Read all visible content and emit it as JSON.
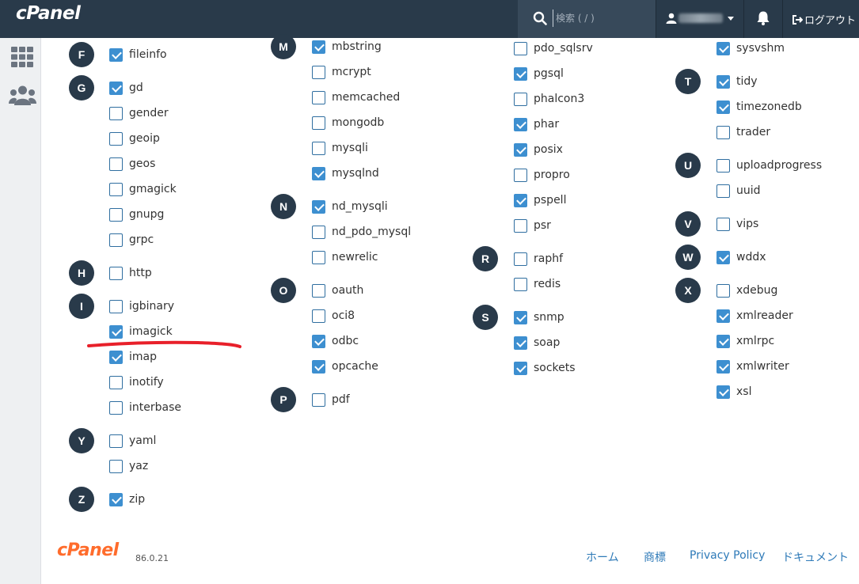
{
  "header": {
    "logo": "cPanel",
    "search_placeholder": "検索 ( / )",
    "logout_label": "ログアウト"
  },
  "groups": [
    {
      "letter": "F",
      "items": [
        {
          "label": "fileinfo",
          "checked": true
        }
      ]
    },
    {
      "letter": "G",
      "items": [
        {
          "label": "gd",
          "checked": true
        },
        {
          "label": "gender",
          "checked": false
        },
        {
          "label": "geoip",
          "checked": false
        },
        {
          "label": "geos",
          "checked": false
        },
        {
          "label": "gmagick",
          "checked": false
        },
        {
          "label": "gnupg",
          "checked": false
        },
        {
          "label": "grpc",
          "checked": false
        }
      ]
    },
    {
      "letter": "H",
      "items": [
        {
          "label": "http",
          "checked": false
        }
      ]
    },
    {
      "letter": "I",
      "items": [
        {
          "label": "igbinary",
          "checked": false
        },
        {
          "label": "imagick",
          "checked": true
        },
        {
          "label": "imap",
          "checked": true
        },
        {
          "label": "inotify",
          "checked": false
        },
        {
          "label": "interbase",
          "checked": false
        }
      ]
    },
    {
      "letter": "Y",
      "items": [
        {
          "label": "yaml",
          "checked": false
        },
        {
          "label": "yaz",
          "checked": false
        }
      ]
    },
    {
      "letter": "Z",
      "items": [
        {
          "label": "zip",
          "checked": true
        }
      ]
    },
    {
      "letter": "M",
      "items": [
        {
          "label": "mbstring",
          "checked": true
        },
        {
          "label": "mcrypt",
          "checked": false
        },
        {
          "label": "memcached",
          "checked": false
        },
        {
          "label": "mongodb",
          "checked": false
        },
        {
          "label": "mysqli",
          "checked": false
        },
        {
          "label": "mysqlnd",
          "checked": true
        }
      ]
    },
    {
      "letter": "N",
      "items": [
        {
          "label": "nd_mysqli",
          "checked": true
        },
        {
          "label": "nd_pdo_mysql",
          "checked": false
        },
        {
          "label": "newrelic",
          "checked": false
        }
      ]
    },
    {
      "letter": "O",
      "items": [
        {
          "label": "oauth",
          "checked": false
        },
        {
          "label": "oci8",
          "checked": false
        },
        {
          "label": "odbc",
          "checked": true
        },
        {
          "label": "opcache",
          "checked": true
        }
      ]
    },
    {
      "letter": "P",
      "items": [
        {
          "label": "pdf",
          "checked": false
        }
      ]
    },
    {
      "letter": "",
      "items": [
        {
          "label": "pdo_sqlsrv",
          "checked": false
        },
        {
          "label": "pgsql",
          "checked": true
        },
        {
          "label": "phalcon3",
          "checked": false
        },
        {
          "label": "phar",
          "checked": true
        },
        {
          "label": "posix",
          "checked": true
        },
        {
          "label": "propro",
          "checked": false
        },
        {
          "label": "pspell",
          "checked": true
        },
        {
          "label": "psr",
          "checked": false
        }
      ]
    },
    {
      "letter": "R",
      "items": [
        {
          "label": "raphf",
          "checked": false
        },
        {
          "label": "redis",
          "checked": false
        }
      ]
    },
    {
      "letter": "S",
      "items": [
        {
          "label": "snmp",
          "checked": true
        },
        {
          "label": "soap",
          "checked": true
        },
        {
          "label": "sockets",
          "checked": true
        }
      ]
    },
    {
      "letter": "",
      "items": [
        {
          "label": "sysvshm",
          "checked": true
        }
      ]
    },
    {
      "letter": "T",
      "items": [
        {
          "label": "tidy",
          "checked": true
        },
        {
          "label": "timezonedb",
          "checked": true
        },
        {
          "label": "trader",
          "checked": false
        }
      ]
    },
    {
      "letter": "U",
      "items": [
        {
          "label": "uploadprogress",
          "checked": false
        },
        {
          "label": "uuid",
          "checked": false
        }
      ]
    },
    {
      "letter": "V",
      "items": [
        {
          "label": "vips",
          "checked": false
        }
      ]
    },
    {
      "letter": "W",
      "items": [
        {
          "label": "wddx",
          "checked": true
        }
      ]
    },
    {
      "letter": "X",
      "items": [
        {
          "label": "xdebug",
          "checked": false
        },
        {
          "label": "xmlreader",
          "checked": true
        },
        {
          "label": "xmlrpc",
          "checked": true
        },
        {
          "label": "xmlwriter",
          "checked": true
        },
        {
          "label": "xsl",
          "checked": true
        }
      ]
    }
  ],
  "footer": {
    "logo": "cPanel",
    "version": "86.0.21",
    "links": [
      "ホーム",
      "商標",
      "Privacy Policy",
      "ドキュメント"
    ]
  },
  "colors": {
    "topbar": "#293a4a",
    "checkbox_checked": "#3d8fd0",
    "annotation_line": "#e8202a",
    "link": "#2e7ab8",
    "brand_orange": "#ff6c2c"
  }
}
